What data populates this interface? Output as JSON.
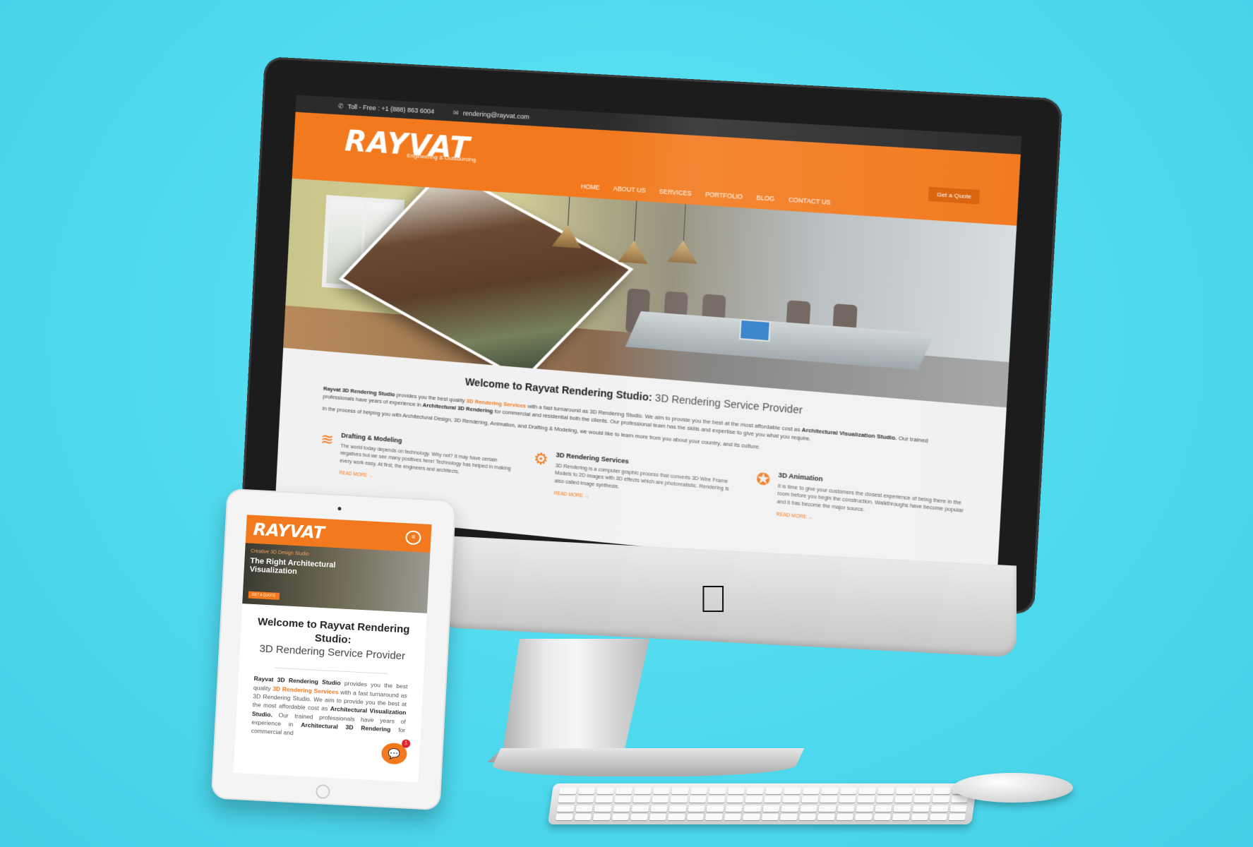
{
  "desktop": {
    "topbar": {
      "phone_label": "Toll - Free : +1 (888) 863 6004",
      "email": "rendering@rayvat.com"
    },
    "logo": "RAYVAT",
    "logo_tagline": "Engineering & Outsourcing",
    "quote_button": "Get a Quote",
    "nav": [
      "HOME",
      "ABOUT US",
      "SERVICES",
      "PORTFOLIO",
      "BLOG",
      "CONTACT US"
    ],
    "welcome_bold": "Welcome to Rayvat Rendering Studio:",
    "welcome_light": " 3D Rendering Service Provider",
    "intro_p1_start": "Rayvat 3D Rendering Studio",
    "intro_p1_a": " provides you the best quality ",
    "intro_p1_link": "3D Rendering Services",
    "intro_p1_b": " with a fast turnaround as 3D Rendering Studio. We aim to provide you the best at the most affordable cost as ",
    "intro_p1_bold2": "Architectural Visualization Studio.",
    "intro_p1_c": " Our trained professionals have years of experience in ",
    "intro_p1_bold3": "Architectural 3D Rendering",
    "intro_p1_d": " for commercial and residential both the clients. Our professional team has the skills and expertise to give you what you require.",
    "intro_p2": "In the process of helping you with Architectural Design, 3D Rendering, Animation, and Drafting & Modeling, we would like to learn more from you about your country, and its culture.",
    "services": [
      {
        "icon": "layers-icon",
        "glyph": "≋",
        "title": "Drafting & Modeling",
        "desc": "The world today depends on technology. Why not? It may have certain negatives but we see many positives here! Technology has helped in making every work easy. At first, the engineers and architects.",
        "more": "READ MORE →"
      },
      {
        "icon": "gear-icon",
        "glyph": "⚙",
        "title": "3D Rendering Services",
        "desc": "3D Rendering is a computer graphic process that converts 3D Wire Frame Models to 2D images with 3D effects which are photorealistic. Rendering is also called image synthesis.",
        "more": "READ MORE →"
      },
      {
        "icon": "lifebuoy-icon",
        "glyph": "✪",
        "title": "3D Animation",
        "desc": "It is time to give your customers the closest experience of being there in the room before you begin the construction. Walkthroughs have become popular and it has become the major source.",
        "more": "READ MORE →"
      }
    ]
  },
  "tablet": {
    "logo": "RAYVAT",
    "menu_icon": "≡",
    "hero_kicker": "Creative 3D Design Studio",
    "hero_title": "The Right Architectural Visualization",
    "hero_button": "GET A QUOTE",
    "welcome_bold": "Welcome to Rayvat Rendering Studio:",
    "welcome_light": "3D Rendering Service Provider",
    "body_bold1": "Rayvat 3D Rendering Studio",
    "body_a": " provides you the best quality ",
    "body_link": "3D Rendering Services",
    "body_b": " with a fast turnaround as 3D Rendering Studio. We aim to provide you the best at the most affordable cost as ",
    "body_bold2": "Architectural Visualization Studio.",
    "body_c": " Our trained professionals have years of experience in ",
    "body_bold3": "Architectural 3D Rendering",
    "body_d": " for commercial and",
    "chat_badge": "1"
  },
  "colors": {
    "brand_orange": "#f2791d",
    "background_cyan": "#55dcef"
  }
}
